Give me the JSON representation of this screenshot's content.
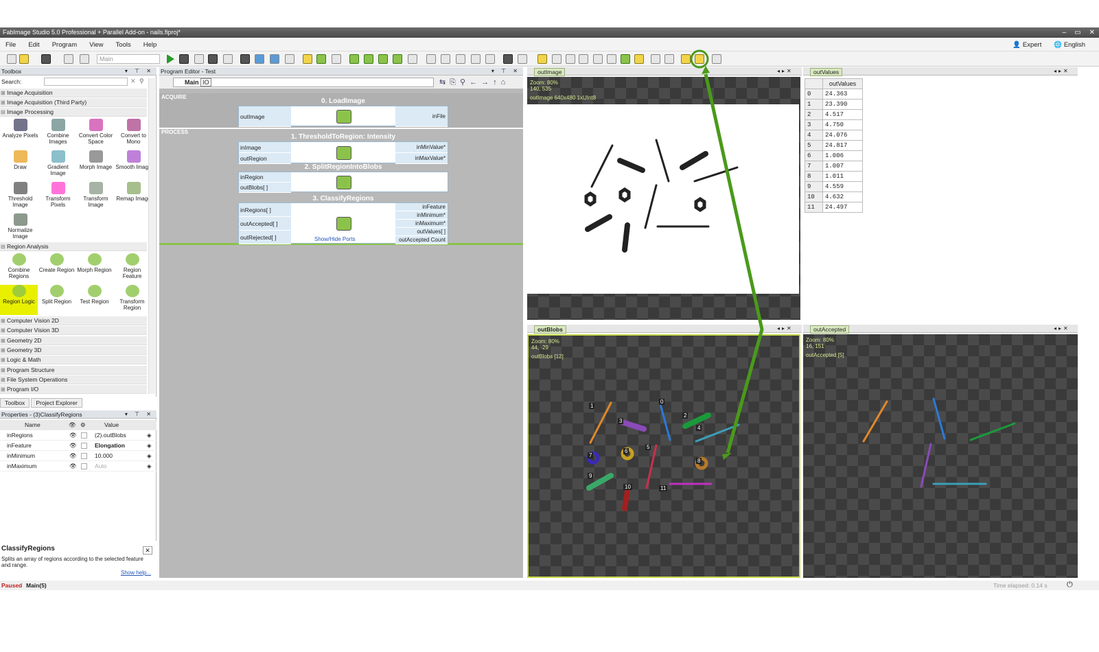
{
  "window": {
    "title": "FabImage Studio 5.0 Professional + Parallel Add-on - nails.fiproj*"
  },
  "menu": [
    "File",
    "Edit",
    "Program",
    "View",
    "Tools",
    "Help"
  ],
  "menu_right": {
    "mode": "Expert",
    "language": "English"
  },
  "toolbar": {
    "worker_combo": "Main"
  },
  "toolbox": {
    "title": "Toolbox",
    "search_label": "Search:",
    "categories_top": [
      "Image Acquisition",
      "Image Acquisition (Third Party)"
    ],
    "image_processing": "Image Processing",
    "ip_tools": [
      "Analyze Pixels",
      "Combine Images",
      "Convert Color Space",
      "Convert to Mono",
      "Draw",
      "Gradient Image",
      "Morph Image",
      "Smooth Image",
      "Threshold Image",
      "Transform Pixels",
      "Transform Image",
      "Remap Image",
      "Normalize Image"
    ],
    "region_analysis": "Region Analysis",
    "ra_tools": [
      "Combine Regions",
      "Create Region",
      "Morph Region",
      "Region Feature",
      "Region Logic",
      "Split Region",
      "Test Region",
      "Transform Region"
    ],
    "categories_bottom": [
      "Computer Vision 2D",
      "Computer Vision 3D",
      "Geometry 2D",
      "Geometry 3D",
      "Logic & Math",
      "Program Structure",
      "File System Operations",
      "Program I/O"
    ],
    "tabs": [
      "Toolbox",
      "Project Explorer"
    ]
  },
  "properties": {
    "title": "Properties - (3)ClassifyRegions",
    "col_name": "Name",
    "col_value": "Value",
    "rows": [
      {
        "name": "inRegions",
        "value": "(2).outBlobs"
      },
      {
        "name": "inFeature",
        "value": "Elongation"
      },
      {
        "name": "inMinimum",
        "value": "10.000"
      },
      {
        "name": "inMaximum",
        "value": "Auto"
      }
    ]
  },
  "help": {
    "title": "ClassifyRegions",
    "text": "Splits an array of regions according to the selected feature and range.",
    "link": "Show help..."
  },
  "editor": {
    "title": "Program Editor - Test",
    "main_combo": "Main",
    "main_badge": "IO",
    "sections": [
      "ACQUIRE",
      "PROCESS"
    ],
    "blocks": [
      {
        "title": "0. LoadImage",
        "left": [
          "outImage"
        ],
        "right": [
          "inFile"
        ]
      },
      {
        "title": "1. ThresholdToRegion: Intensity",
        "left": [
          "inImage",
          "outRegion"
        ],
        "right": [
          "inMinValue*",
          "inMaxValue*"
        ]
      },
      {
        "title": "2. SplitRegionIntoBlobs",
        "left": [
          "inRegion",
          "outBlobs[ ]"
        ],
        "right": []
      },
      {
        "title": "3. ClassifyRegions",
        "left": [
          "inRegions[ ]",
          "outAccepted[ ]",
          "outRejected[ ]"
        ],
        "right": [
          "inFeature",
          "inMinimum*",
          "inMaximum*",
          "outValues[ ]",
          "outAccepted Count"
        ],
        "link": "Show/Hide Ports"
      }
    ]
  },
  "views": {
    "outImage": {
      "tab": "outImage",
      "zoom": "Zoom: 80%",
      "coords": "140, 535",
      "info": "outImage 640x480 1xUInt8"
    },
    "outValues": {
      "tab": "outValues",
      "header": "outValues",
      "values": [
        "24.363",
        "23.390",
        "4.517",
        "4.750",
        "24.076",
        "24.817",
        "1.006",
        "1.007",
        "1.011",
        "4.559",
        "4.632",
        "24.497"
      ]
    },
    "outBlobs": {
      "tab": "outBlobs",
      "zoom": "Zoom: 80%",
      "coords": "44, -29",
      "info": "outBlobs [12]",
      "labels": [
        "0",
        "1",
        "2",
        "3",
        "4",
        "5",
        "6",
        "7",
        "8",
        "9",
        "10",
        "11"
      ]
    },
    "outAccepted": {
      "tab": "outAccepted",
      "zoom": "Zoom: 80%",
      "coords": "16, 151",
      "info": "outAccepted [5]"
    }
  },
  "status": {
    "state": "Paused",
    "context": "Main(5)",
    "elapsed": "Time elapsed: 0.14 s"
  },
  "colors": {
    "accent_green": "#4a9a1a",
    "highlight": "#e8f000"
  }
}
